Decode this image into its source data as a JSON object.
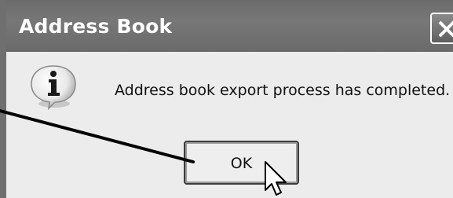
{
  "dialog": {
    "title": "Address Book",
    "message": "Address book export process has completed.",
    "ok_label": "OK",
    "icons": {
      "close": "close-icon",
      "info": "info-icon",
      "cursor": "mouse-pointer-icon"
    }
  }
}
